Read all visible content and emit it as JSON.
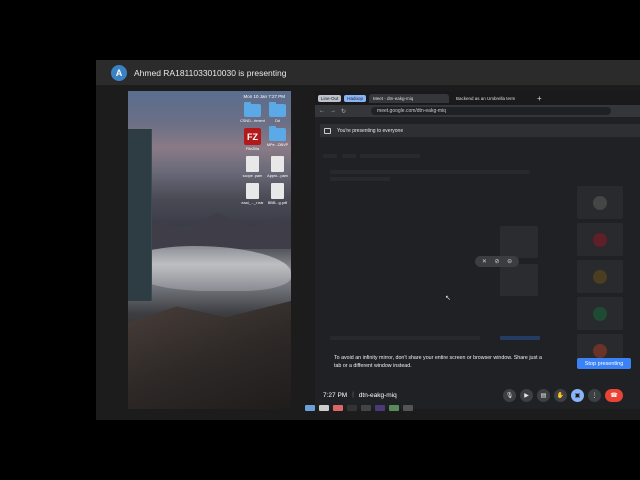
{
  "banner": {
    "avatar_letter": "A",
    "text": "Ahmed RA1811033010030 is presenting",
    "avatar_color": "#3b82c4"
  },
  "desktop": {
    "menubar_time": "Mon 10 Jan  7:27 PM",
    "icons": [
      {
        "label": "CSND...rtment",
        "kind": "folder"
      },
      {
        "label": "Dd",
        "kind": "folder"
      },
      {
        "label": "FileZilla",
        "kind": "filezilla"
      },
      {
        "label": "MPe...DBVP",
        "kind": "folder"
      },
      {
        "label": "scope .pam",
        "kind": "doc"
      },
      {
        "label": "Appro...pam",
        "kind": "doc"
      },
      {
        "label": "eaai_..._r.ear",
        "kind": "doc"
      },
      {
        "label": "BBB...g.pdf",
        "kind": "doc"
      }
    ]
  },
  "browser": {
    "pills": [
      "Line-Out",
      "Hadoop"
    ],
    "tabs": [
      {
        "label": "Meet - dtn-eakg-miq",
        "active": true
      },
      {
        "label": "Backend as an Umbrella term",
        "active": false
      }
    ],
    "new_tab": "+",
    "url": "meet.google.com/dtn-eakg-miq",
    "presenting_strip": "You're presenting to everyone",
    "mirror_message": "To avoid an infinity mirror, don't share your entire screen or browser window. Share just a tab or a different window instead.",
    "stop_button": "Stop presenting",
    "time": "7:27 PM",
    "separator": "|",
    "meeting_code": "dtn-eakg-miq",
    "controls": [
      {
        "name": "mic-button",
        "glyph": "🎙"
      },
      {
        "name": "camera-button",
        "glyph": "▶"
      },
      {
        "name": "captions-button",
        "glyph": "▤"
      },
      {
        "name": "raise-hand-button",
        "glyph": "✋"
      },
      {
        "name": "present-button",
        "glyph": "▣"
      },
      {
        "name": "more-options-button",
        "glyph": "⋮"
      },
      {
        "name": "leave-call-button",
        "glyph": "☎"
      }
    ]
  }
}
